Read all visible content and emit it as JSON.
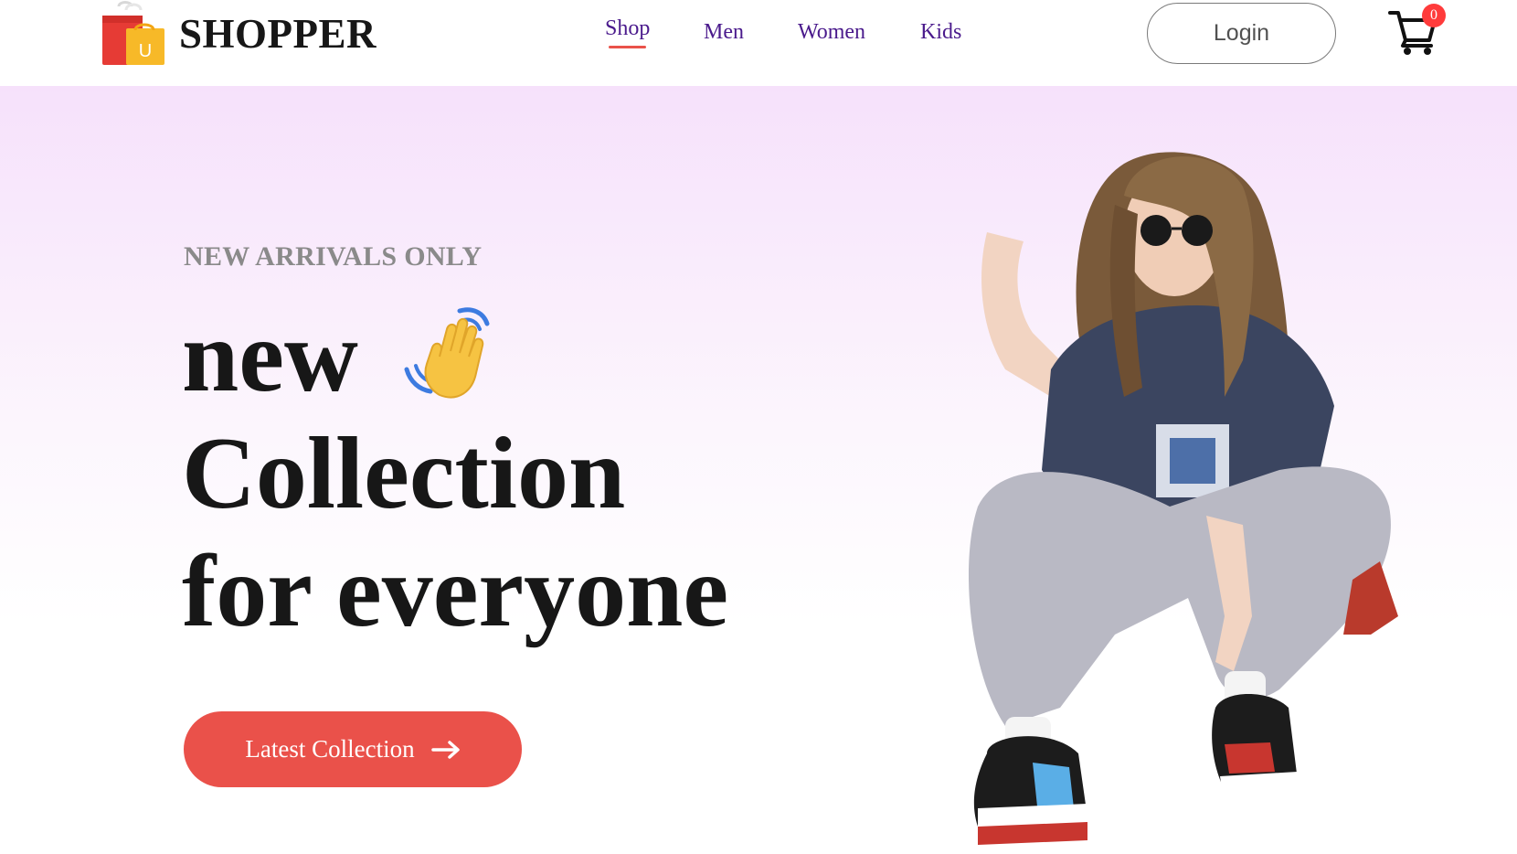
{
  "brand": {
    "name": "SHOPPER",
    "logo_icon": "shopping-bag-icon",
    "logo_letter": "U"
  },
  "nav": {
    "items": [
      {
        "label": "Shop",
        "active": true
      },
      {
        "label": "Men"
      },
      {
        "label": "Women"
      },
      {
        "label": "Kids"
      }
    ]
  },
  "header": {
    "login_label": "Login",
    "cart_icon": "cart-icon",
    "cart_count": "0"
  },
  "hero": {
    "tagline": "NEW ARRIVALS ONLY",
    "line1": "new",
    "line2": "Collection",
    "line3": "for everyone",
    "hand_icon": "waving-hand-icon",
    "cta_label": "Latest Collection",
    "cta_icon": "arrow-right-icon",
    "image_icon": "model-photo"
  },
  "colors": {
    "accent": "#ea514a",
    "nav_text": "#4a1a8c",
    "badge": "#ff3b3b",
    "hero_gradient_top": "#f6e1fb",
    "hero_gradient_bottom": "#ffffff"
  }
}
